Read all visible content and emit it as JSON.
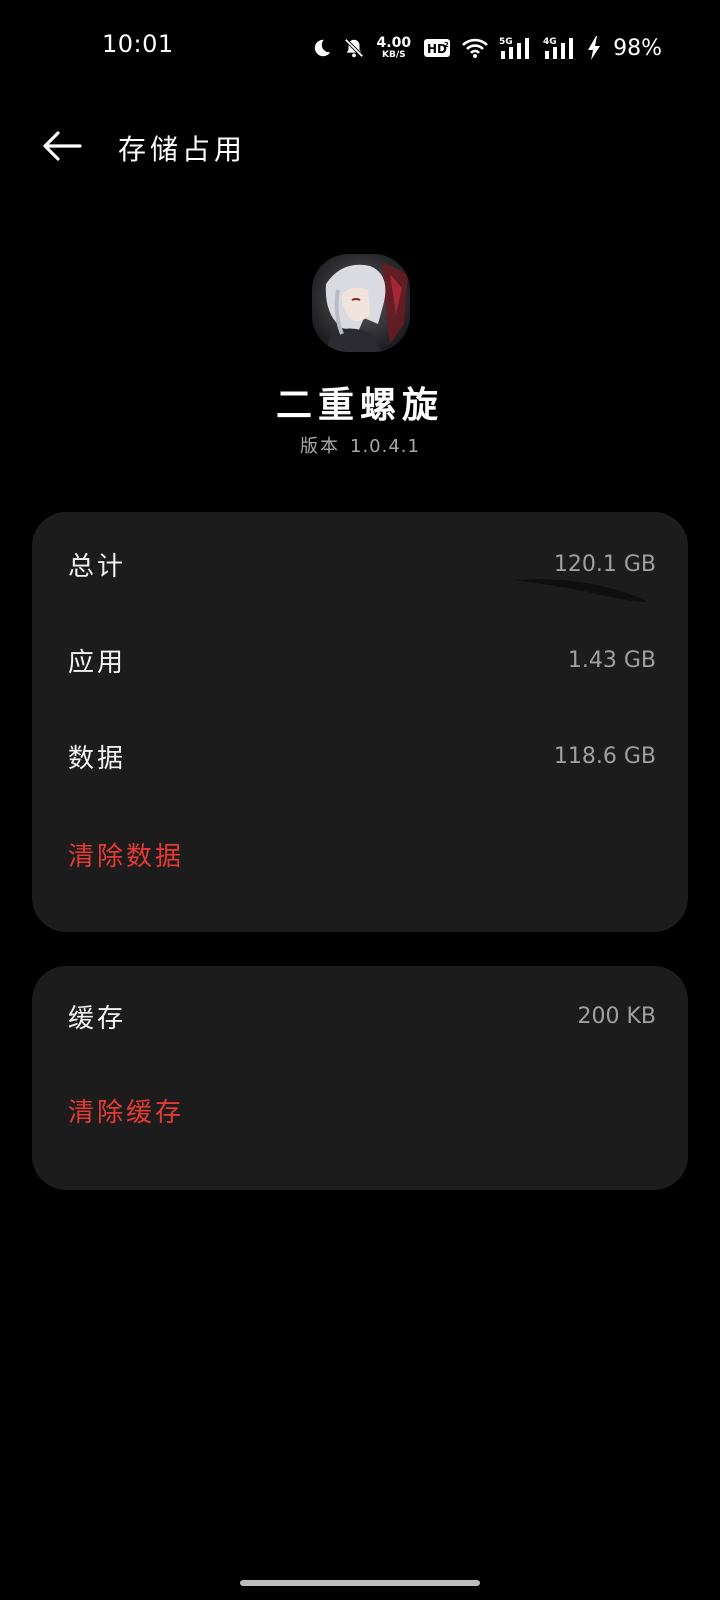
{
  "status_bar": {
    "time": "10:01",
    "net_speed_value": "4.00",
    "net_speed_unit": "KB/S",
    "hd_badge": "HD",
    "signal_1_label": "5G",
    "signal_2_label": "4G",
    "battery": "98%",
    "icons": [
      "moon-icon",
      "bell-off-icon",
      "hd-icon",
      "wifi-icon",
      "signal-5g-icon",
      "signal-4g-icon",
      "charging-icon"
    ]
  },
  "header": {
    "title": "存储占用"
  },
  "app": {
    "name": "二重螺旋",
    "version_label": "版本",
    "version": "1.0.4.1"
  },
  "storage": {
    "rows": [
      {
        "label": "总计",
        "value": "120.1 GB"
      },
      {
        "label": "应用",
        "value": "1.43 GB"
      },
      {
        "label": "数据",
        "value": "118.6 GB"
      }
    ],
    "clear_data_label": "清除数据"
  },
  "cache": {
    "label": "缓存",
    "value": "200 KB",
    "clear_cache_label": "清除缓存"
  },
  "colors": {
    "background": "#000000",
    "card": "#1c1c1c",
    "accent_red": "#e53935",
    "secondary_text": "#a0a0a0"
  }
}
